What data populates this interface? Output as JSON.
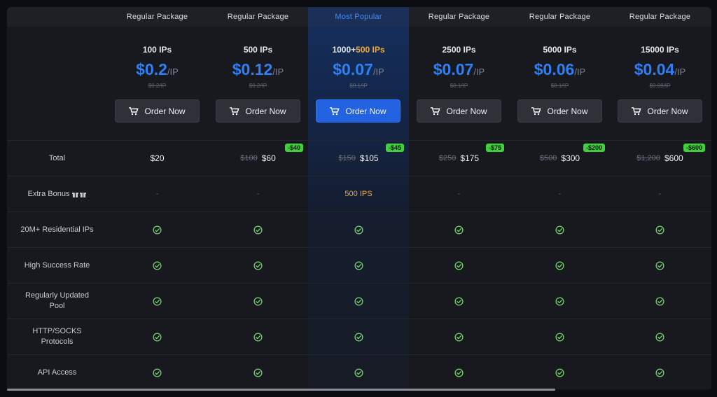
{
  "header": {
    "columns": [
      {
        "label": "Regular Package"
      },
      {
        "label": "Regular Package"
      },
      {
        "label": "Most Popular"
      },
      {
        "label": "Regular Package"
      },
      {
        "label": "Regular Package"
      },
      {
        "label": "Regular Package"
      }
    ]
  },
  "packages": [
    {
      "ips": "100 IPs",
      "ips_extra": "",
      "price": "$0.2",
      "unit": "/IP",
      "old_price": "$0.2/IP",
      "order_label": "Order Now"
    },
    {
      "ips": "500 IPs",
      "ips_extra": "",
      "price": "$0.12",
      "unit": "/IP",
      "old_price": "$0.2/IP",
      "order_label": "Order Now"
    },
    {
      "ips": "1000+",
      "ips_extra": "500 IPs",
      "price": "$0.07",
      "unit": "/IP",
      "old_price": "$0.1/IP",
      "order_label": "Order Now"
    },
    {
      "ips": "2500 IPs",
      "ips_extra": "",
      "price": "$0.07",
      "unit": "/IP",
      "old_price": "$0.1/IP",
      "order_label": "Order Now"
    },
    {
      "ips": "5000 IPs",
      "ips_extra": "",
      "price": "$0.06",
      "unit": "/IP",
      "old_price": "$0.1/IP",
      "order_label": "Order Now"
    },
    {
      "ips": "15000 IPs",
      "ips_extra": "",
      "price": "$0.04",
      "unit": "/IP",
      "old_price": "$0.08/IP",
      "order_label": "Order Now"
    }
  ],
  "rows": {
    "total": {
      "label": "Total",
      "cells": [
        {
          "old": "",
          "now": "$20",
          "badge": ""
        },
        {
          "old": "$100",
          "now": "$60",
          "badge": "-$40"
        },
        {
          "old": "$150",
          "now": "$105",
          "badge": "-$45"
        },
        {
          "old": "$250",
          "now": "$175",
          "badge": "-$75"
        },
        {
          "old": "$500",
          "now": "$300",
          "badge": "-$200"
        },
        {
          "old": "$1,200",
          "now": "$600",
          "badge": "-$600"
        }
      ]
    },
    "bonus": {
      "label": "Extra Bonus",
      "cells": [
        "-",
        "-",
        "500 IPS",
        "-",
        "-",
        "-"
      ]
    },
    "features": [
      {
        "label": "20M+ Residential IPs"
      },
      {
        "label": "High Success Rate"
      },
      {
        "label": "Regularly Updated Pool"
      },
      {
        "label": "HTTP/SOCKS Protocols"
      },
      {
        "label": "API Access"
      }
    ]
  },
  "colors": {
    "accent_blue": "#2f7ff5",
    "accent_orange": "#f2a93b",
    "badge_green": "#3ed13b",
    "check_green": "#6fd46a"
  },
  "icons": {
    "cart": "cart-icon",
    "check": "check-circle-icon",
    "gift": "gift-icon"
  }
}
